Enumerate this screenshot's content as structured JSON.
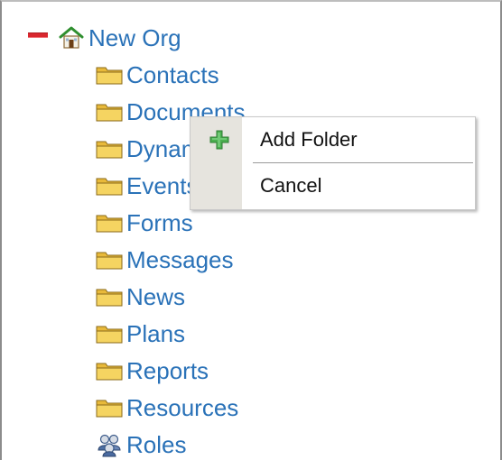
{
  "tree": {
    "root": {
      "label": "New Org",
      "expand_icon": "minus-icon",
      "icon": "house-icon"
    },
    "children": [
      {
        "label": "Contacts",
        "icon": "folder-icon"
      },
      {
        "label": "Documents",
        "icon": "folder-icon"
      },
      {
        "label": "Dynamic Content",
        "icon": "folder-icon"
      },
      {
        "label": "Events",
        "icon": "folder-icon"
      },
      {
        "label": "Forms",
        "icon": "folder-icon"
      },
      {
        "label": "Messages",
        "icon": "folder-icon"
      },
      {
        "label": "News",
        "icon": "folder-icon"
      },
      {
        "label": "Plans",
        "icon": "folder-icon"
      },
      {
        "label": "Reports",
        "icon": "folder-icon"
      },
      {
        "label": "Resources",
        "icon": "folder-icon"
      },
      {
        "label": "Roles",
        "icon": "people-icon"
      }
    ]
  },
  "context_menu": {
    "items": [
      {
        "label": "Add Folder",
        "icon": "plus-icon"
      },
      {
        "label": "Cancel",
        "icon": ""
      }
    ]
  },
  "colors": {
    "link": "#2a72b8",
    "collapse": "#d9272e",
    "folder": "#f2c94c",
    "gutter": "#e6e4de",
    "plus": "#4caf50"
  }
}
